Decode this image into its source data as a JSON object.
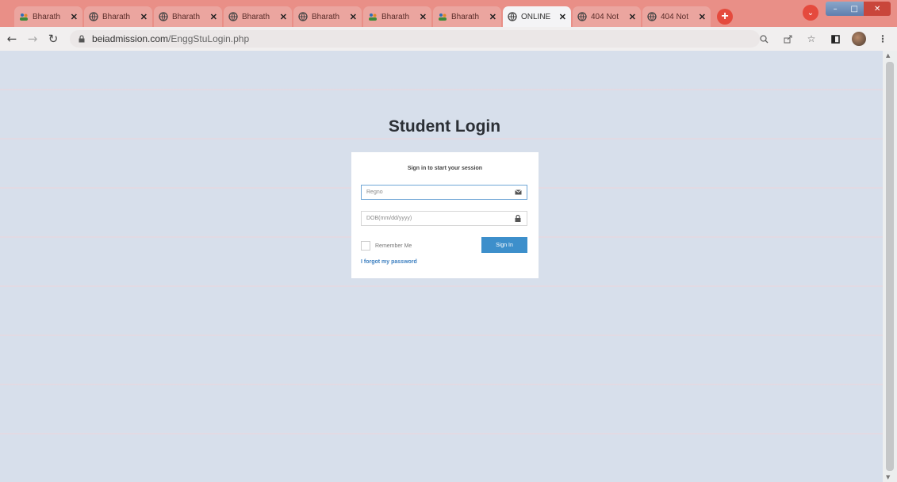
{
  "browser": {
    "tabs": [
      {
        "label": "Bharath",
        "icon": "people-icon",
        "active": false
      },
      {
        "label": "Bharath",
        "icon": "globe-icon",
        "active": false
      },
      {
        "label": "Bharath",
        "icon": "globe-icon",
        "active": false
      },
      {
        "label": "Bharath",
        "icon": "globe-icon",
        "active": false
      },
      {
        "label": "Bharath",
        "icon": "globe-icon",
        "active": false
      },
      {
        "label": "Bharath",
        "icon": "people-icon",
        "active": false
      },
      {
        "label": "Bharath",
        "icon": "people-icon",
        "active": false
      },
      {
        "label": "ONLINE",
        "icon": "globe-icon",
        "active": true
      },
      {
        "label": "404 Not",
        "icon": "globe-icon",
        "active": false
      },
      {
        "label": "404 Not",
        "icon": "globe-icon",
        "active": false
      }
    ],
    "url_domain": "beiadmission.com",
    "url_path": "/EnggStuLogin.php"
  },
  "page": {
    "title": "Student Login",
    "message": "Sign in to start your session",
    "regno_placeholder": "Regno",
    "dob_placeholder": "DOB(mm/dd/yyyy)",
    "remember_label": "Remember Me",
    "signin_label": "Sign In",
    "forgot_label": "I forgot my password"
  },
  "colors": {
    "tabstrip": "#e98f87",
    "page_bg": "#d7dfeb",
    "button": "#3d8fcb",
    "link": "#3c7fc0"
  }
}
